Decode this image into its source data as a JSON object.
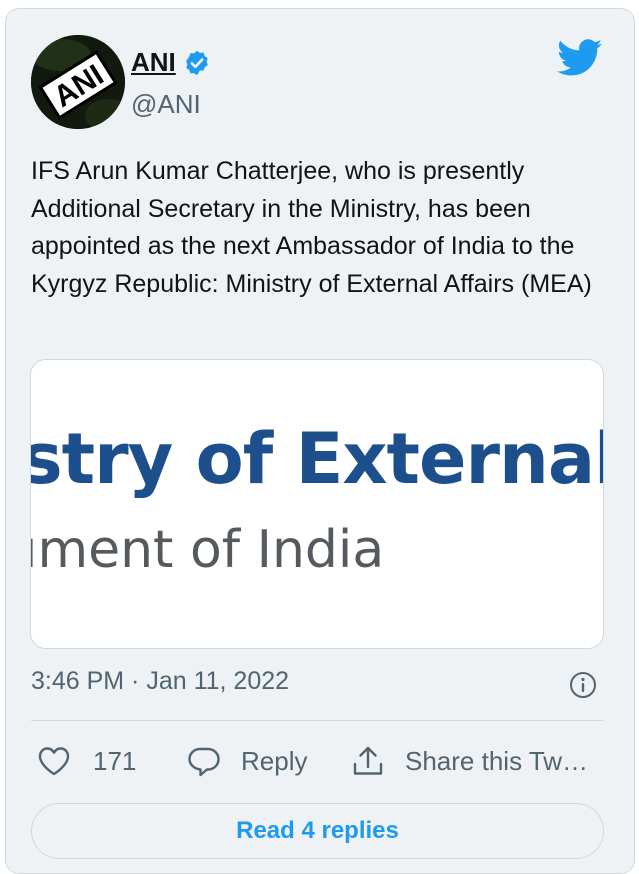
{
  "author": {
    "name": "ANI",
    "handle": "@ANI",
    "avatar_text": "ANI",
    "verified": true
  },
  "tweet": {
    "text": "IFS Arun Kumar Chatterjee, who is presently Additional Secretary in the Ministry, has been appointed as the next Ambassador of India to the Kyrgyz Republic: Ministry of External Affairs (MEA)",
    "timestamp": "3:46 PM · Jan 11, 2022"
  },
  "link_card": {
    "line1": "stry of External A",
    "line2": "ıment of India"
  },
  "actions": {
    "like_count": "171",
    "reply_label": "Reply",
    "share_label": "Share this Tw…"
  },
  "read_replies_label": "Read 4 replies",
  "icons": {
    "brand": "twitter-bird-icon",
    "verified": "verified-badge-icon",
    "info": "info-icon",
    "like": "heart-icon",
    "reply": "reply-bubble-icon",
    "share": "share-upload-icon"
  },
  "colors": {
    "accent": "#1d9bf0",
    "card_background": "#eef2f5",
    "secondary_text": "#536471",
    "mea_blue": "#1d4f8c"
  }
}
